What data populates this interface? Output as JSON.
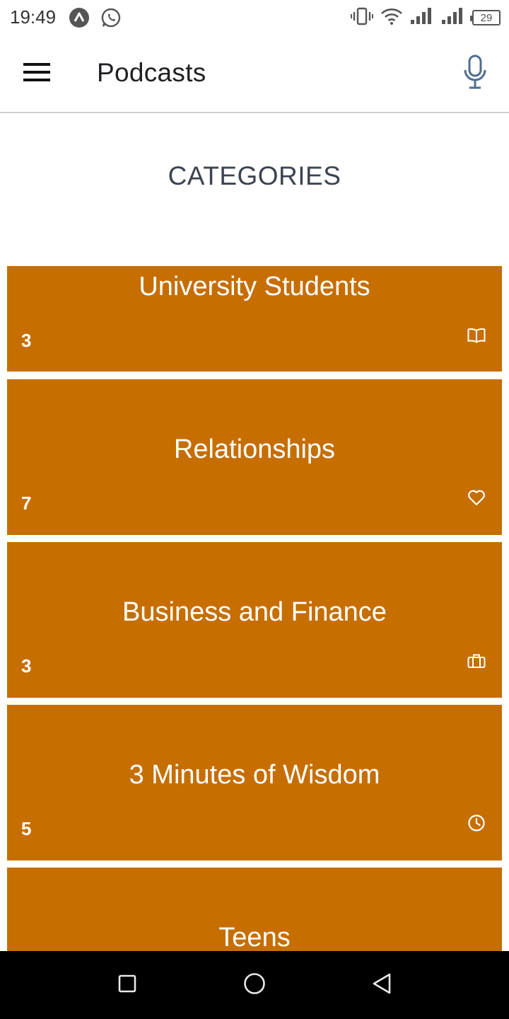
{
  "status_bar": {
    "time": "19:49",
    "battery_level": "29",
    "icons": [
      "launcher-a-icon",
      "whatsapp-icon",
      "vibrate-icon",
      "wifi-icon",
      "signal-icon",
      "signal-icon",
      "battery-icon"
    ]
  },
  "app_bar": {
    "title": "Podcasts",
    "menu_icon": "hamburger-menu-icon",
    "mic_icon": "microphone-icon"
  },
  "section": {
    "title": "CATEGORIES"
  },
  "categories": [
    {
      "title": "University Students",
      "count": "3",
      "icon": "book-icon"
    },
    {
      "title": "Relationships",
      "count": "7",
      "icon": "heart-icon"
    },
    {
      "title": "Business and Finance",
      "count": "3",
      "icon": "briefcase-icon"
    },
    {
      "title": "3 Minutes of Wisdom",
      "count": "5",
      "icon": "clock-icon"
    },
    {
      "title": "Teens",
      "count": "",
      "icon": ""
    }
  ],
  "colors": {
    "card_background": "#c66e00",
    "card_text": "#ffffff",
    "section_title": "#3c4451",
    "nav_bar": "#000000"
  },
  "nav_bar": {
    "icons": [
      "recent-apps-icon",
      "home-icon",
      "back-icon"
    ]
  }
}
